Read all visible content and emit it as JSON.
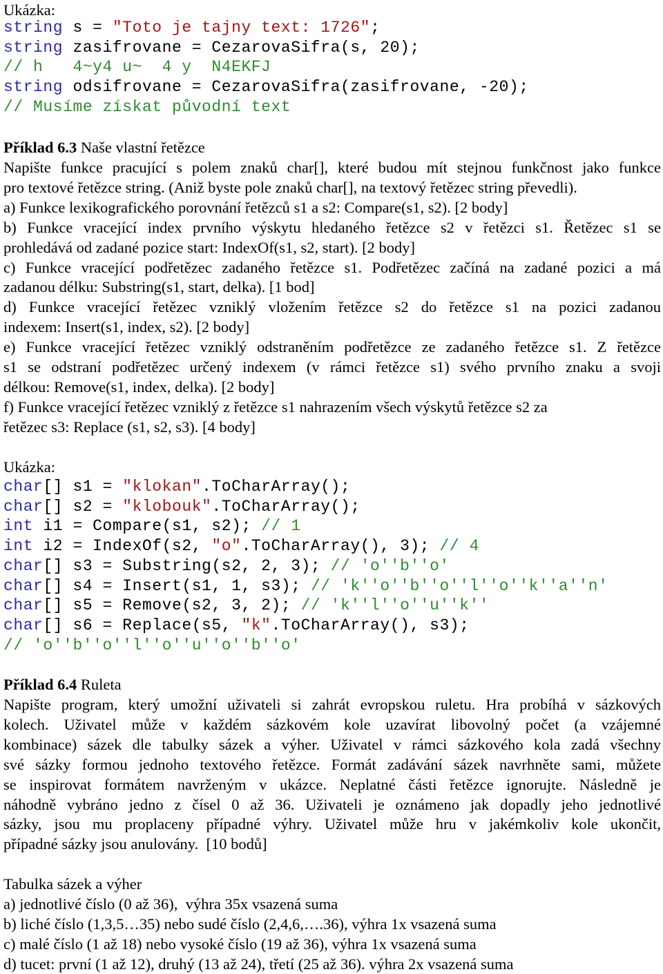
{
  "section1": {
    "sample_label": "Ukázka:",
    "code": [
      [
        {
          "t": "kw",
          "v": "string"
        },
        {
          "t": "pl",
          "v": " s = "
        },
        {
          "t": "str",
          "v": "\"Toto je tajny text: 1726\""
        },
        {
          "t": "pl",
          "v": ";"
        }
      ],
      [
        {
          "t": "kw",
          "v": "string"
        },
        {
          "t": "pl",
          "v": " zasifrovane = CezarovaSifra(s, 20);"
        }
      ],
      [
        {
          "t": "cm",
          "v": "// h   4~y4 u~  4 y  N4EKFJ"
        }
      ],
      [
        {
          "t": "kw",
          "v": "string"
        },
        {
          "t": "pl",
          "v": " odsifrovane = CezarovaSifra(zasifrovane, -20);"
        }
      ],
      [
        {
          "t": "cm",
          "v": "// Musíme získat původní text"
        }
      ]
    ]
  },
  "example63": {
    "heading_bold": "Příklad 6.3",
    "heading_rest": " Naše vlastní řetězce",
    "lines": [
      {
        "text": "Napište funkce pracující s polem znaků char[], které budou mít stejnou funkčnost jako funkce",
        "justify": true
      },
      {
        "text": "pro textové řetězce string. (Aniž byste pole znaků char[], na textový řetězec string převedli).",
        "justify": false
      },
      {
        "text": "a) Funkce lexikografického porovnání řetězců s1 a s2: Compare(s1, s2). [2 body]",
        "justify": false
      },
      {
        "text": "b) Funkce vracející index prvního výskytu hledaného řetězce s2 v řetězci s1. Řetězec s1 se",
        "justify": true
      },
      {
        "text": "prohledává od zadané pozice start: IndexOf(s1, s2, start). [2 body]",
        "justify": false
      },
      {
        "text": "c) Funkce vracející podřetězec zadaného řetězce s1. Podřetězec začíná na zadané pozici a má",
        "justify": true
      },
      {
        "text": "zadanou délku: Substring(s1, start, delka). [1 bod]",
        "justify": false
      },
      {
        "text": "d) Funkce vracející řetězec vzniklý vložením řetězce s2 do řetězce s1 na pozici zadanou",
        "justify": true
      },
      {
        "text": "indexem: Insert(s1, index, s2). [2 body]",
        "justify": false
      },
      {
        "text": "e) Funkce vracející řetězec vzniklý odstraněním podřetězce ze zadaného řetězce s1. Z řetězce",
        "justify": true
      },
      {
        "text": "s1 se odstraní podřetězec určený indexem (v rámci řetězce s1) svého prvního znaku a svoji",
        "justify": true
      },
      {
        "text": "délkou: Remove(s1, index, delka). [2 body]",
        "justify": false
      },
      {
        "text": "f) Funkce vracející řetězec vzniklý z řetězce s1 nahrazením všech výskytů řetězce s2 za",
        "justify": false
      },
      {
        "text": "řetězec s3: Replace (s1, s2, s3). [4 body]",
        "justify": false
      }
    ]
  },
  "section2": {
    "sample_label": "Ukázka:",
    "code": [
      [
        {
          "t": "kw",
          "v": "char"
        },
        {
          "t": "pl",
          "v": "[] s1 = "
        },
        {
          "t": "str",
          "v": "\"klokan\""
        },
        {
          "t": "pl",
          "v": ".ToCharArray();"
        }
      ],
      [
        {
          "t": "kw",
          "v": "char"
        },
        {
          "t": "pl",
          "v": "[] s2 = "
        },
        {
          "t": "str",
          "v": "\"klobouk\""
        },
        {
          "t": "pl",
          "v": ".ToCharArray();"
        }
      ],
      [
        {
          "t": "kw",
          "v": "int"
        },
        {
          "t": "pl",
          "v": " i1 = Compare(s1, s2); "
        },
        {
          "t": "cm",
          "v": "// 1"
        }
      ],
      [
        {
          "t": "kw",
          "v": "int"
        },
        {
          "t": "pl",
          "v": " i2 = IndexOf(s2, "
        },
        {
          "t": "str",
          "v": "\"o\""
        },
        {
          "t": "pl",
          "v": ".ToCharArray(), 3); "
        },
        {
          "t": "cm",
          "v": "// 4"
        }
      ],
      [
        {
          "t": "kw",
          "v": "char"
        },
        {
          "t": "pl",
          "v": "[] s3 = Substring(s2, 2, 3); "
        },
        {
          "t": "cm",
          "v": "// 'o''b''o'"
        }
      ],
      [
        {
          "t": "kw",
          "v": "char"
        },
        {
          "t": "pl",
          "v": "[] s4 = Insert(s1, 1, s3); "
        },
        {
          "t": "cm",
          "v": "// 'k''o''b''o''l''o''k''a''n'"
        }
      ],
      [
        {
          "t": "kw",
          "v": "char"
        },
        {
          "t": "pl",
          "v": "[] s5 = Remove(s2, 3, 2); "
        },
        {
          "t": "cm",
          "v": "// 'k''l''o''u''k''"
        }
      ],
      [
        {
          "t": "kw",
          "v": "char"
        },
        {
          "t": "pl",
          "v": "[] s6 = Replace(s5, "
        },
        {
          "t": "str",
          "v": "\"k\""
        },
        {
          "t": "pl",
          "v": ".ToCharArray(), s3);"
        }
      ],
      [
        {
          "t": "cm",
          "v": "// 'o''b''o''l''o''u''o''b''o'"
        }
      ]
    ]
  },
  "example64": {
    "heading_bold": "Příklad 6.4",
    "heading_rest": " Ruleta",
    "lines": [
      {
        "text": "Napište program, který umožní uživateli si zahrát evropskou ruletu. Hra probíhá v sázkových",
        "justify": true
      },
      {
        "text": "kolech. Uživatel může v každém sázkovém kole uzavírat libovolný počet (a vzájemné",
        "justify": true
      },
      {
        "text": "kombinace) sázek dle tabulky sázek a výher. Uživatel v rámci sázkového kola zadá všechny",
        "justify": true
      },
      {
        "text": "své sázky formou jednoho textového řetězce. Formát zadávání sázek navrhněte sami, můžete",
        "justify": true
      },
      {
        "text": "se inspirovat  formátem navrženým v ukázce. Neplatné části řetězce ignorujte. Následně je",
        "justify": true
      },
      {
        "text": "náhodně vybráno jedno z čísel 0 až 36. Uživateli je oznámeno jak dopadly jeho jednotlivé",
        "justify": true
      },
      {
        "text": "sázky, jsou mu proplaceny případné výhry. Uživatel může hru v jakémkoliv kole ukončit,",
        "justify": true
      },
      {
        "text": "případné sázky jsou anulovány.  [10 bodů]",
        "justify": false
      }
    ]
  },
  "bets_table": {
    "title": "Tabulka sázek a výher",
    "rows": [
      "a) jednotlivé číslo (0 až 36),  výhra 35x vsazená suma",
      "b) liché číslo (1,3,5…35) nebo sudé číslo (2,4,6,….36), výhra 1x vsazená suma",
      "c) malé číslo (1 až 18) nebo vysoké číslo (19 až 36), výhra 1x vsazená suma",
      "d) tucet: první (1 až 12), druhý (13 až 24), třetí (25 až 36). výhra 2x vsazená suma"
    ]
  }
}
